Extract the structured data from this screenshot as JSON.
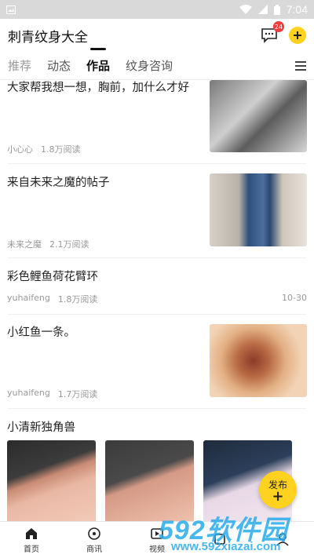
{
  "status_bar": {
    "time": "7:04"
  },
  "header": {
    "title": "刺青纹身大全",
    "message_badge": "24"
  },
  "tabs": [
    "推荐",
    "动态",
    "作品",
    "纹身咨询"
  ],
  "active_tab_index": 2,
  "feed": [
    {
      "title": "大家帮我想一想，胸前，加什么才好",
      "author": "小心心",
      "reads": "1.8万阅读"
    },
    {
      "title": "来自未来之魔的帖子",
      "author": "未来之魔",
      "reads": "2.1万阅读"
    },
    {
      "title": "彩色鲤鱼荷花臂环",
      "author": "yuhaifeng",
      "reads": "1.8万阅读",
      "date": "10-30"
    },
    {
      "title": "小红鱼一条。",
      "author": "yuhaifeng",
      "reads": "1.7万阅读"
    },
    {
      "title": "小清新独角兽"
    }
  ],
  "fab": {
    "label": "发布",
    "symbol": "+"
  },
  "bottom_nav": [
    {
      "label": "首页",
      "icon": "home-icon"
    },
    {
      "label": "商讯",
      "icon": "search-icon"
    },
    {
      "label": "视频",
      "icon": "video-icon"
    },
    {
      "label": "",
      "icon": "discover-icon"
    },
    {
      "label": "",
      "icon": "profile-icon"
    }
  ],
  "watermark": {
    "big": "592软件园",
    "small": "www.592xiazai.com"
  },
  "colors": {
    "accent": "#ffd21f",
    "badge": "#f23b3b",
    "watermark": "#28aaeb"
  }
}
